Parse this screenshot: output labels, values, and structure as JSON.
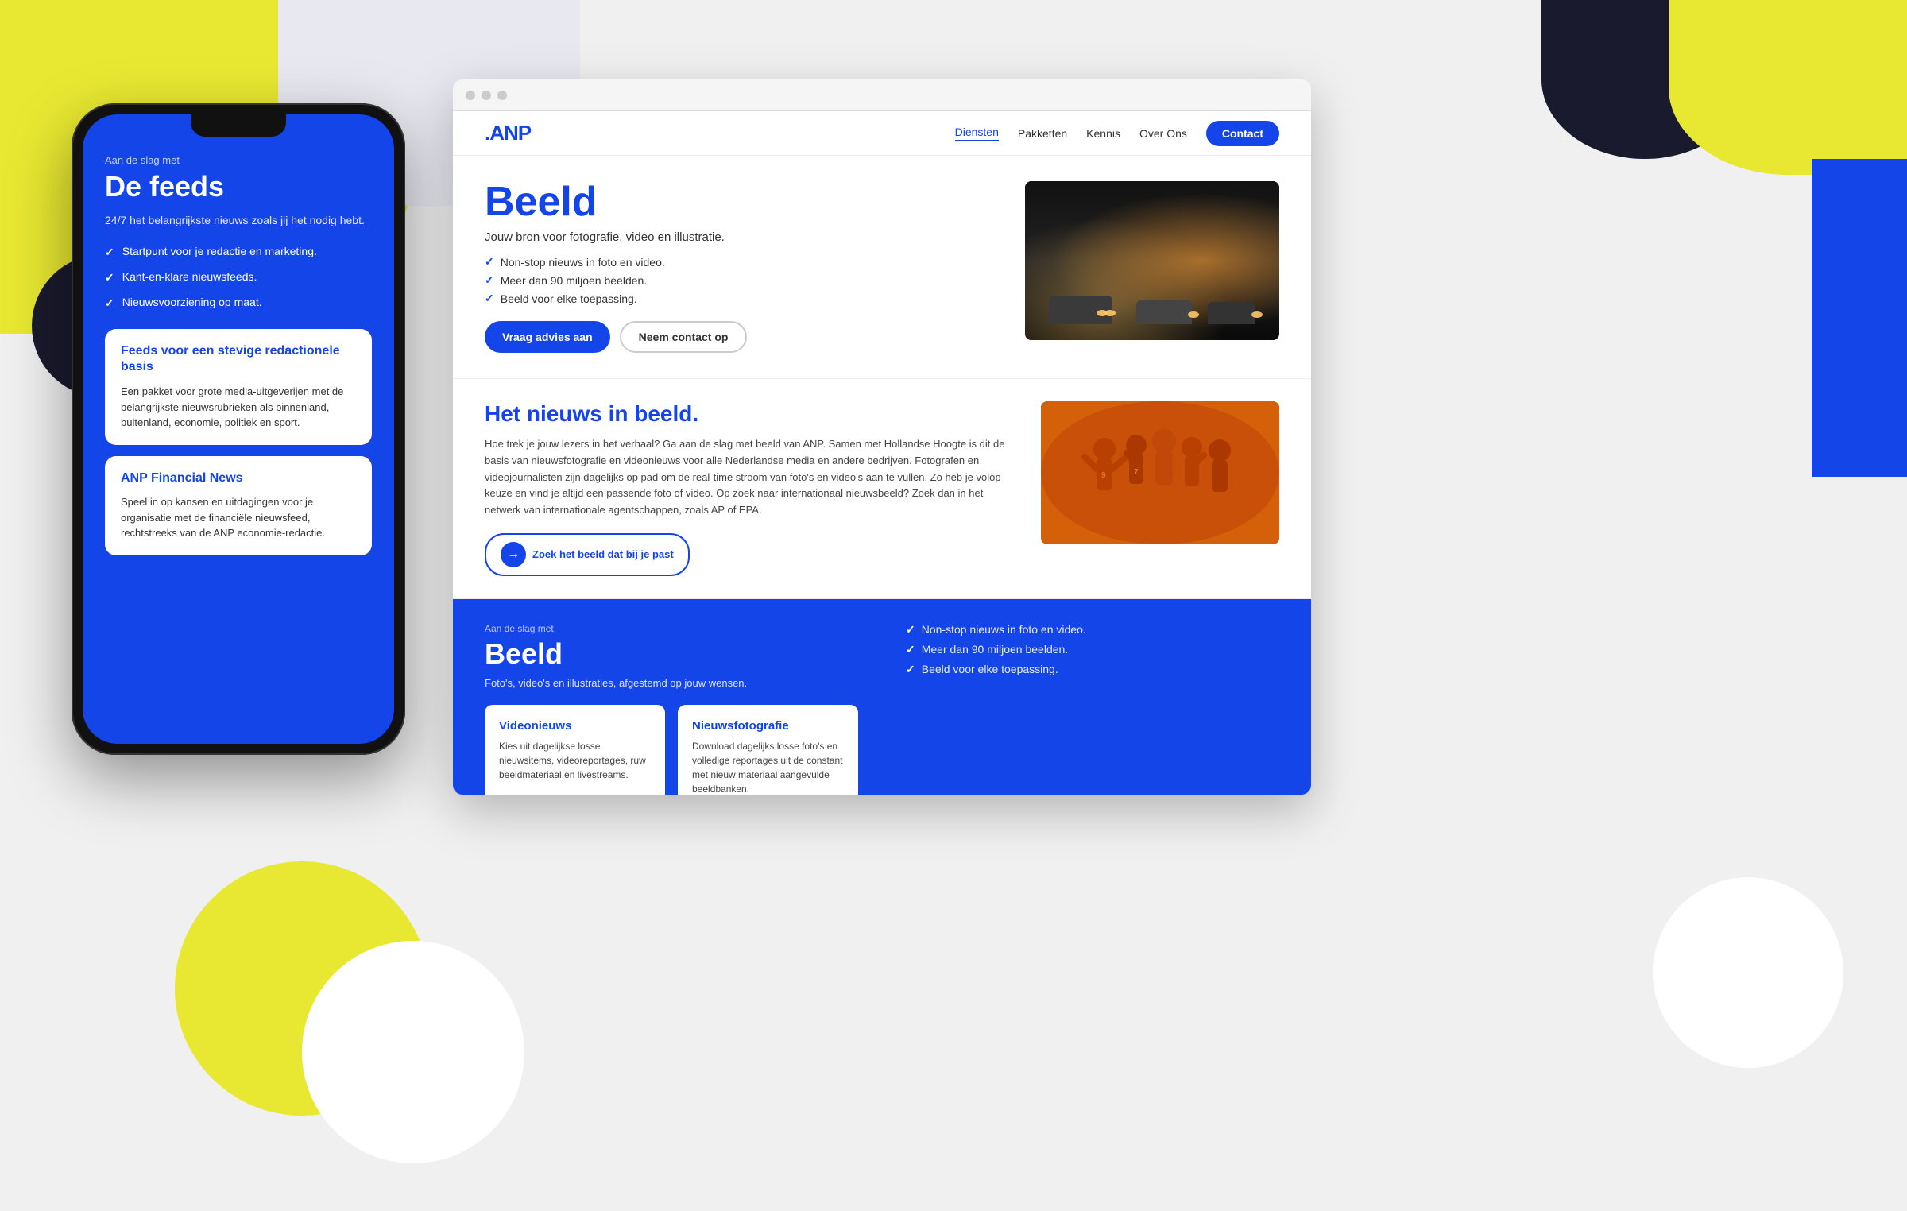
{
  "background": {
    "colors": {
      "yellow": "#e8e832",
      "blue": "#1445e8",
      "dark": "#1a1a2e",
      "white": "#ffffff",
      "lightGray": "#e8e8f0"
    }
  },
  "phone": {
    "label": "Aan de slag met",
    "title": "De feeds",
    "description": "24/7 het belangrijkste nieuws zoals jij het nodig hebt.",
    "checklist": [
      "Startpunt voor je redactie en marketing.",
      "Kant-en-klare nieuwsfeeds.",
      "Nieuwsvoorziening op maat."
    ],
    "card1": {
      "title": "Feeds voor een stevige redactionele basis",
      "text": "Een pakket voor grote media-uitgeverijen met de belangrijkste nieuwsrubrieken als binnenland, buitenland, economie, politiek en sport."
    },
    "card2": {
      "title": "ANP Financial News",
      "text": "Speel in op kansen en uitdagingen voor je organisatie met de financiële nieuwsfeed, rechtstreeks van de ANP economie-redactie."
    }
  },
  "browser": {
    "nav": {
      "logo": ".ANP",
      "links": [
        "Diensten",
        "Pakketten",
        "Kennis",
        "Over Ons"
      ],
      "contact": "Contact"
    },
    "hero": {
      "title": "Beeld",
      "subtitle": "Jouw bron voor fotografie, video en illustratie.",
      "checklist": [
        "Non-stop nieuws in foto en video.",
        "Meer dan 90 miljoen beelden.",
        "Beeld voor elke toepassing."
      ],
      "btn_primary": "Vraag advies aan",
      "btn_outline": "Neem contact op"
    },
    "section_middle": {
      "title": "Het nieuws in beeld.",
      "text": "Hoe trek je jouw lezers in het verhaal? Ga aan de slag met beeld van ANP. Samen met Hollandse Hoogte is dit de basis van nieuwsfotografie en videonieuws voor alle Nederlandse media en andere bedrijven. Fotografen en videojournalisten zijn dagelijks op pad om de real-time stroom van foto's en video's aan te vullen. Zo heb je volop keuze en vind je altijd een passende foto of video. Op zoek naar internationaal nieuwsbeeld? Zoek dan in het netwerk van internationale agentschappen, zoals AP of EPA.",
      "link": "Zoek het beeld dat bij je past"
    },
    "blue_section": {
      "label": "Aan de slag met",
      "title": "Beeld",
      "description": "Foto's, video's en illustraties, afgestemd op jouw wensen.",
      "checklist": [
        "Non-stop nieuws in foto en video.",
        "Meer dan 90 miljoen beelden.",
        "Beeld voor elke toepassing."
      ],
      "card1": {
        "title": "Videonieuws",
        "text": "Kies uit dagelijkse losse nieuwsitems, videoreportages, ruw beeldmateriaal en livestreams."
      },
      "card2": {
        "title": "Nieuwsfotografie",
        "text": "Download dagelijks losse foto's en volledige reportages uit de constant met nieuw materiaal aangevulde beeldbanken."
      }
    }
  }
}
